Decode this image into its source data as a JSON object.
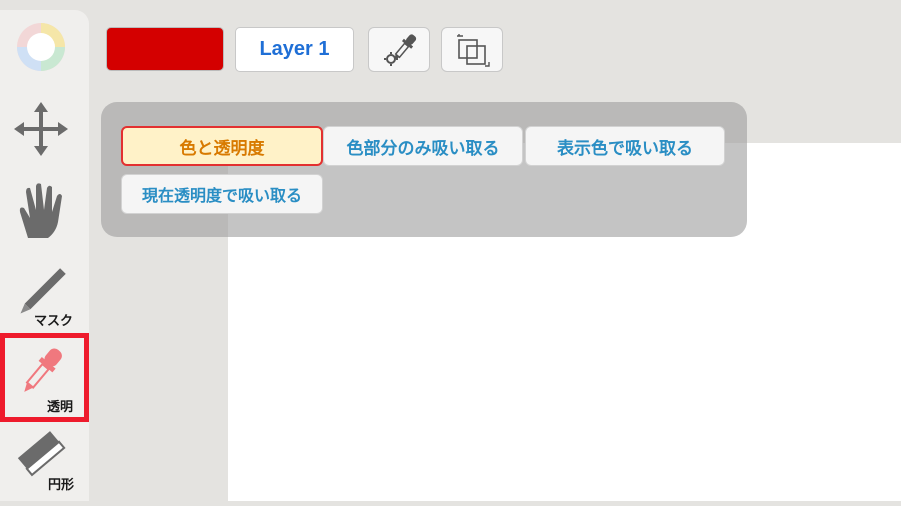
{
  "toolbar": {
    "color_swatch": "#d40000",
    "layer_label": "Layer 1",
    "eyedropper_settings_icon": "eyedropper-gear-icon",
    "transform_icon": "transform-icon"
  },
  "sidebar": {
    "tools": [
      {
        "name": "color-wheel",
        "label": ""
      },
      {
        "name": "move",
        "label": ""
      },
      {
        "name": "hand",
        "label": ""
      },
      {
        "name": "mask-pen",
        "label": "マスク"
      },
      {
        "name": "transparency-dropper",
        "label": "透明",
        "selected": true
      },
      {
        "name": "eraser",
        "label": "円形"
      }
    ]
  },
  "popup": {
    "options": [
      {
        "label": "色と透明度",
        "active": true
      },
      {
        "label": "色部分のみ吸い取る"
      },
      {
        "label": "表示色で吸い取る"
      },
      {
        "label": "現在透明度で吸い取る"
      }
    ]
  }
}
